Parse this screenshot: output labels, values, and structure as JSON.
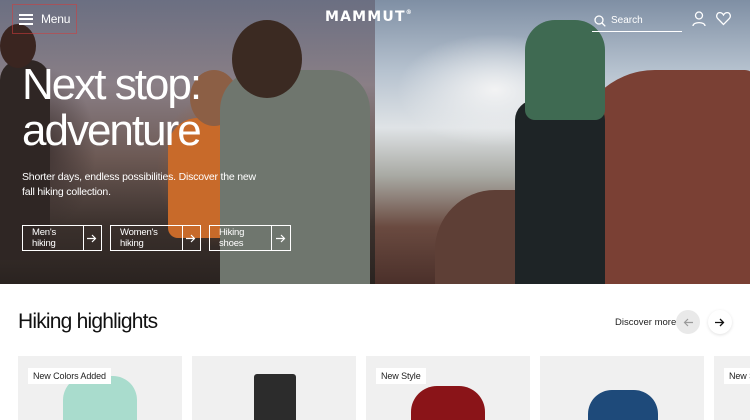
{
  "header": {
    "menu_label": "Menu",
    "logo_text": "MAMMUT",
    "logo_mark": "®",
    "search_label": "Search"
  },
  "hero": {
    "headline_line1": "Next stop:",
    "headline_line2": "adventure",
    "subline": "Shorter days, endless possibilities. Discover the new fall hiking collection.",
    "ctas": [
      {
        "label": "Men's hiking",
        "icon": "arrow-right-icon"
      },
      {
        "label": "Women's hiking",
        "icon": "arrow-right-icon"
      },
      {
        "label": "Hiking shoes",
        "icon": "arrow-right-icon"
      }
    ]
  },
  "highlights": {
    "title": "Hiking highlights",
    "discover_label": "Discover more",
    "products": [
      {
        "badge": "New Colors Added",
        "color": "#a9dccd"
      },
      {
        "badge": "",
        "color": "#2c2c2c"
      },
      {
        "badge": "New Style",
        "color": "#8a1418"
      },
      {
        "badge": "",
        "color": "#1e4a7a"
      },
      {
        "badge": "New St"
      }
    ]
  },
  "colors": {
    "hero_text": "#ffffff",
    "page_bg": "#ffffff",
    "card_bg": "#f0f0f0"
  }
}
